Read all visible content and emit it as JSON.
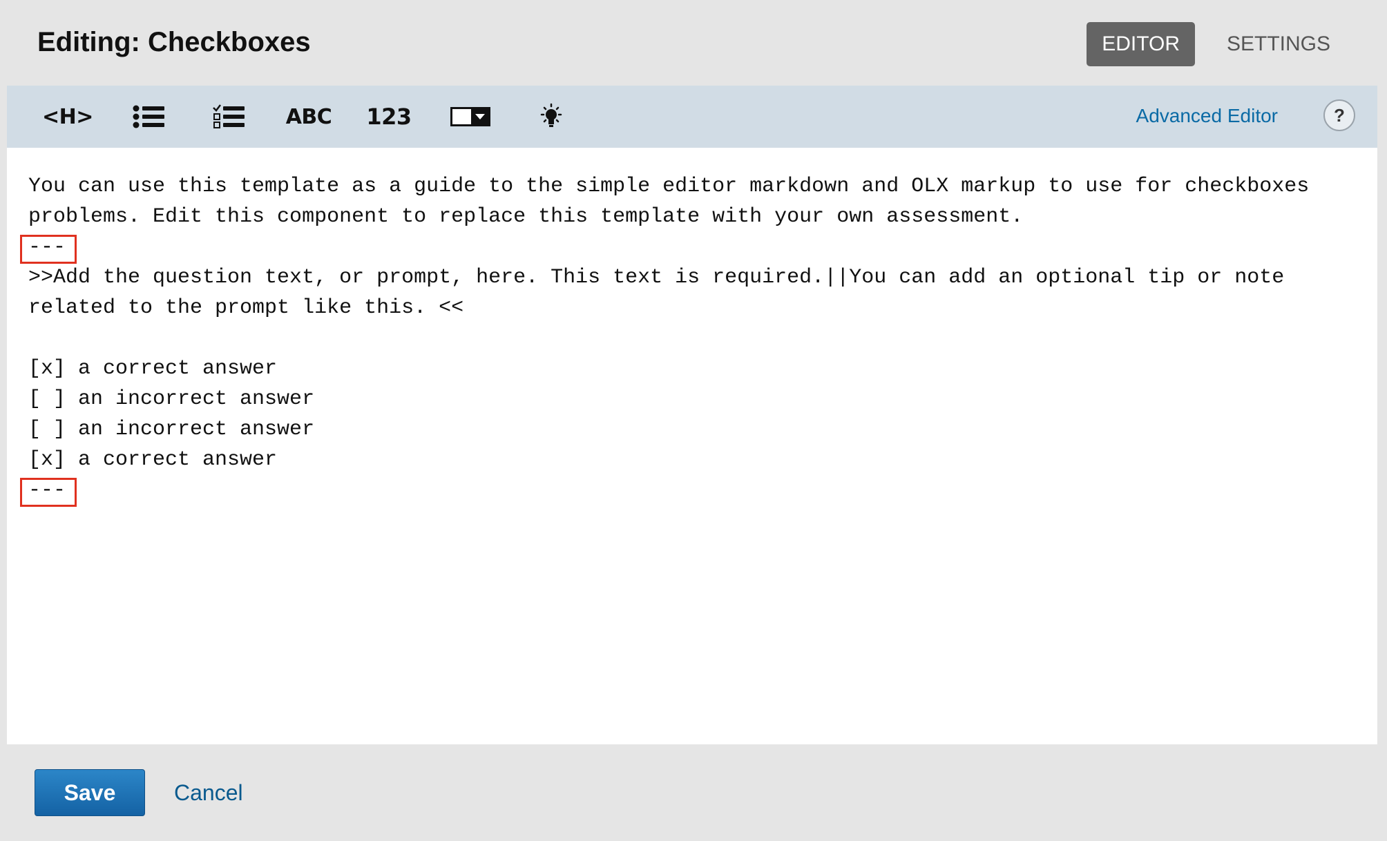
{
  "header": {
    "title": "Editing: Checkboxes",
    "tabs": [
      {
        "label": "EDITOR",
        "active": true
      },
      {
        "label": "SETTINGS",
        "active": false
      }
    ]
  },
  "toolbar": {
    "buttons": [
      {
        "label": "<H>",
        "icon": "heading-icon"
      },
      {
        "label": "",
        "icon": "bullet-list-icon"
      },
      {
        "label": "",
        "icon": "checklist-icon"
      },
      {
        "label": "ABC",
        "icon": "text-input-icon"
      },
      {
        "label": "123",
        "icon": "numerical-input-icon"
      },
      {
        "label": "",
        "icon": "dropdown-icon"
      },
      {
        "label": "",
        "icon": "lightbulb-icon"
      }
    ],
    "advanced_editor": "Advanced Editor",
    "help": "?"
  },
  "editor": {
    "lines": [
      "You can use this template as a guide to the simple editor markdown and OLX markup to use for checkboxes",
      "problems. Edit this component to replace this template with your own assessment.",
      "---",
      ">>Add the question text, or prompt, here. This text is required.||You can add an optional tip or note",
      "related to the prompt like this. <<",
      "",
      "[x] a correct answer",
      "[ ] an incorrect answer",
      "[ ] an incorrect answer",
      "[x] a correct answer",
      "---"
    ]
  },
  "footer": {
    "save_label": "Save",
    "cancel_label": "Cancel"
  },
  "colors": {
    "toolbar_bg": "#d1dce5",
    "active_tab_bg": "#646464",
    "link": "#0a6aa5",
    "save_bg": "#1a6fb3",
    "highlight": "#e0311f"
  }
}
